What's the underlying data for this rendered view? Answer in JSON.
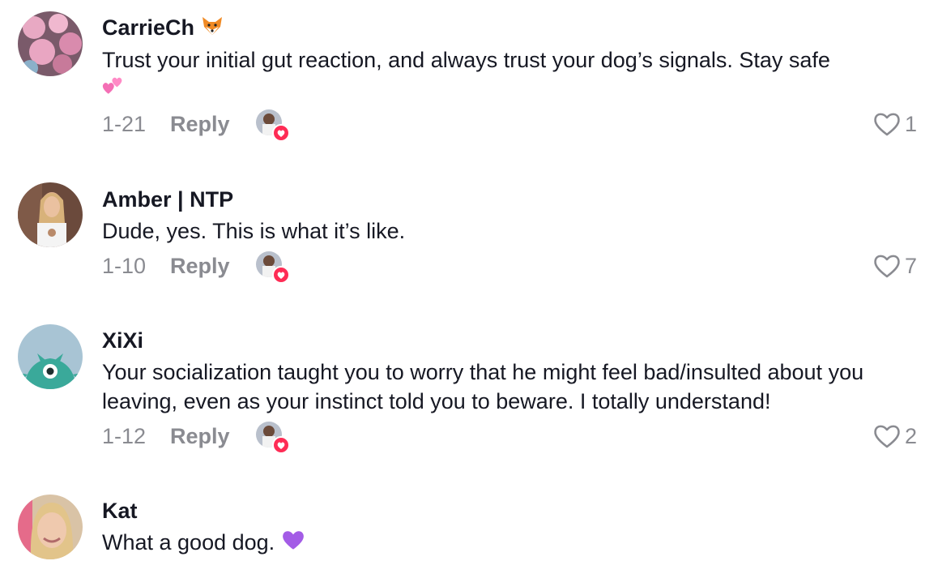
{
  "comments": [
    {
      "username": "CarrieCh",
      "username_emoji": "fox-icon",
      "text": "Trust your initial gut reaction, and always trust your dog’s signals. Stay safe",
      "trailing_emoji": "two-hearts-icon",
      "date": "1-21",
      "reply_label": "Reply",
      "likes": "1",
      "liked_by_creator": true
    },
    {
      "username": "Amber | NTP",
      "text": "Dude, yes. This is what it’s like.",
      "date": "1-10",
      "reply_label": "Reply",
      "likes": "7",
      "liked_by_creator": true
    },
    {
      "username": "XiXi",
      "text": "Your socialization taught you to worry that he might feel bad/insulted about you leaving, even as your instinct told you to beware. I totally understand!",
      "date": "1-12",
      "reply_label": "Reply",
      "likes": "2",
      "liked_by_creator": true
    },
    {
      "username": "Kat",
      "text": "What a good dog.",
      "trailing_emoji": "purple-heart-icon"
    }
  ],
  "colors": {
    "text": "#161823",
    "secondary": "#8a8b91",
    "creator_heart": "#fe2c55"
  }
}
